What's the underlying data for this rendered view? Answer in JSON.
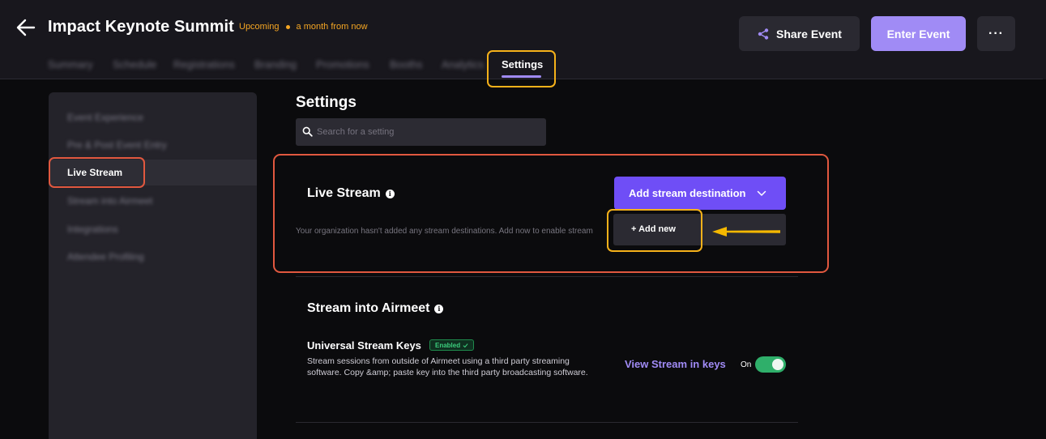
{
  "header": {
    "title": "Impact Keynote Summit",
    "status": "Upcoming",
    "relative_time": "a month from now",
    "share_label": "Share Event",
    "enter_label": "Enter Event",
    "more_label": "···"
  },
  "tabs": [
    {
      "label": "Summary"
    },
    {
      "label": "Schedule"
    },
    {
      "label": "Registrations"
    },
    {
      "label": "Branding"
    },
    {
      "label": "Promotions"
    },
    {
      "label": "Booths"
    },
    {
      "label": "Analytics"
    }
  ],
  "active_tab": "Settings",
  "sidebar": {
    "items": [
      {
        "label": "Event Experience"
      },
      {
        "label": "Pre & Post Event Entry"
      },
      {
        "label": "Live Stream"
      },
      {
        "label": "Stream into Airmeet"
      },
      {
        "label": "Integrations"
      },
      {
        "label": "Attendee Profiling"
      }
    ]
  },
  "main": {
    "title": "Settings",
    "search_placeholder": "Search for a setting",
    "live_stream": {
      "title": "Live Stream",
      "add_destination_label": "Add stream destination",
      "description": "Your organization hasn't added any stream destinations. Add now to enable stream",
      "dropdown_item": "+ Add new"
    },
    "stream_into": {
      "title": "Stream into Airmeet",
      "usk_title": "Universal Stream Keys",
      "usk_badge": "Enabled",
      "usk_desc": "Stream sessions from outside of Airmeet using a third party streaming software. Copy &amp; paste key into the third party broadcasting software.",
      "view_link": "View Stream in keys",
      "toggle_label": "On"
    }
  },
  "colors": {
    "accent": "#6f4ef6",
    "accent_light": "#a08bf5",
    "status_orange": "#f5a623",
    "highlight_yellow": "#f5b11a",
    "highlight_red": "#e1583f",
    "toggle_green": "#2faf6a"
  }
}
